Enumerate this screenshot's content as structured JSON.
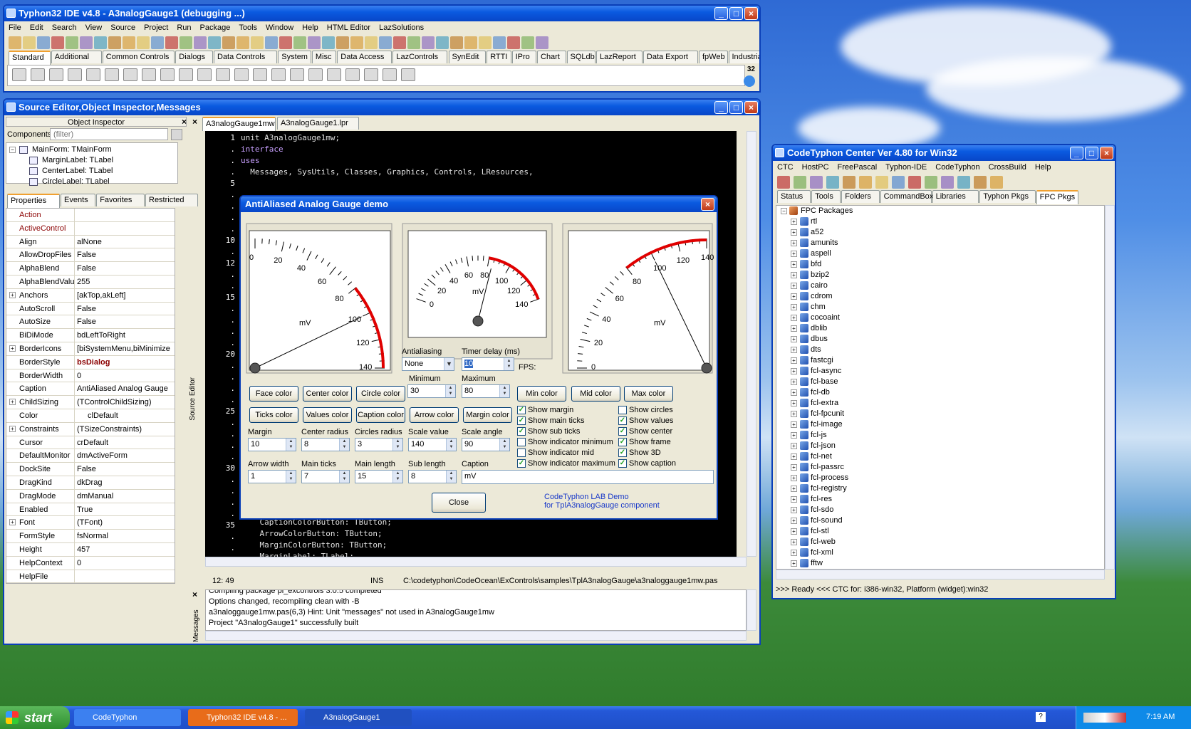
{
  "ide": {
    "title": "Typhon32 IDE v4.8 - A3nalogGauge1 (debugging ...)",
    "menu": [
      "File",
      "Edit",
      "Search",
      "View",
      "Source",
      "Project",
      "Run",
      "Package",
      "Tools",
      "Window",
      "Help",
      "HTML Editor",
      "LazSolutions"
    ],
    "palette_tabs": [
      "Standard",
      "Additional",
      "Common Controls",
      "Dialogs",
      "Data Controls",
      "System",
      "Misc",
      "Data Access",
      "LazControls",
      "SynEdit",
      "RTTI",
      "IPro",
      "Chart",
      "SQLdb",
      "LazReport",
      "Data Export",
      "fpWeb",
      "Industrial",
      "ActiveX",
      "W"
    ],
    "counter": "32"
  },
  "editor": {
    "title": "Source Editor,Object Inspector,Messages",
    "oi_title": "Object Inspector",
    "components_label": "Components",
    "filter_placeholder": "(filter)",
    "tree": [
      "MainForm: TMainForm",
      "MarginLabel: TLabel",
      "CenterLabel: TLabel",
      "CircleLabel: TLabel"
    ],
    "oi_tabs": [
      "Properties",
      "Events",
      "Favorites",
      "Restricted"
    ],
    "props": [
      [
        "Action",
        ""
      ],
      [
        "ActiveControl",
        ""
      ],
      [
        "Align",
        "alNone"
      ],
      [
        "AllowDropFiles",
        "False"
      ],
      [
        "AlphaBlend",
        "False"
      ],
      [
        "AlphaBlendValue",
        "255"
      ],
      [
        "Anchors",
        "[akTop,akLeft]"
      ],
      [
        "AutoScroll",
        "False"
      ],
      [
        "AutoSize",
        "False"
      ],
      [
        "BiDiMode",
        "bdLeftToRight"
      ],
      [
        "BorderIcons",
        "[biSystemMenu,biMinimize"
      ],
      [
        "BorderStyle",
        "bsDialog"
      ],
      [
        "BorderWidth",
        "0"
      ],
      [
        "Caption",
        "AntiAliased Analog Gauge"
      ],
      [
        "ChildSizing",
        "(TControlChildSizing)"
      ],
      [
        "Color",
        "clDefault"
      ],
      [
        "Constraints",
        "(TSizeConstraints)"
      ],
      [
        "Cursor",
        "crDefault"
      ],
      [
        "DefaultMonitor",
        "dmActiveForm"
      ],
      [
        "DockSite",
        "False"
      ],
      [
        "DragKind",
        "dkDrag"
      ],
      [
        "DragMode",
        "dmManual"
      ],
      [
        "Enabled",
        "True"
      ],
      [
        "Font",
        "(TFont)"
      ],
      [
        "FormStyle",
        "fsNormal"
      ],
      [
        "Height",
        "457"
      ],
      [
        "HelpContext",
        "0"
      ],
      [
        "HelpFile",
        ""
      ]
    ],
    "file_tabs": [
      "A3nalogGauge1mw",
      "A3nalogGauge1.lpr"
    ],
    "gutter": [
      "1",
      ".",
      ".",
      ".",
      "5",
      ".",
      ".",
      ".",
      ".",
      "10",
      ".",
      "12",
      ".",
      ".",
      "15",
      ".",
      ".",
      ".",
      ".",
      "20",
      ".",
      ".",
      ".",
      ".",
      "25",
      ".",
      ".",
      ".",
      ".",
      "30",
      ".",
      ".",
      ".",
      ".",
      "35",
      ".",
      "."
    ],
    "code_top": [
      "unit A3nalogGauge1mw;",
      "",
      "interface",
      "",
      "uses",
      "  Messages, SysUtils, Classes, Graphics, Controls, LResources,"
    ],
    "code_bottom": [
      "    CaptionColorButton: TButton;",
      "    ArrowColorButton: TButton;",
      "    MarginColorButton: TButton;",
      "    MarginLabel: TLabel;"
    ],
    "side_label": "Source Editor",
    "status": {
      "pos": "12: 49",
      "mode": "INS",
      "path": "C:\\codetyphon\\CodeOcean\\ExControls\\samples\\TplA3nalogGauge\\a3naloggauge1mw.pas"
    },
    "msg_label": "Messages",
    "messages": [
      "Compiling package pl_excontrols 3.0.5  completed",
      "Options changed, recompiling clean with -B",
      "a3naloggauge1mw.pas(6,3) Hint: Unit \"messages\" not used in A3nalogGauge1mw",
      "Project \"A3nalogGauge1\" successfully built"
    ]
  },
  "dialog": {
    "title": "AntiAliased Analog Gauge demo",
    "gauge_unit": "mV",
    "g1_ticks": [
      "0",
      "20",
      "40",
      "60",
      "80",
      "100",
      "120",
      "140"
    ],
    "antialiasing_label": "Antialiasing",
    "antialiasing_value": "None",
    "timer_label": "Timer delay (ms)",
    "timer_value": "10",
    "fps_label": "FPS:",
    "min_label": "Minimum",
    "min_value": "30",
    "max_label": "Maximum",
    "max_value": "80",
    "buttons_row1": [
      "Face color",
      "Center color",
      "Circle color"
    ],
    "buttons_row1b": [
      "Min color",
      "Mid color",
      "Max color"
    ],
    "buttons_row2": [
      "Ticks color",
      "Values color",
      "Caption color",
      "Arrow color",
      "Margin color"
    ],
    "checks_left": [
      [
        "Show margin",
        true
      ],
      [
        "Show main ticks",
        true
      ],
      [
        "Show sub ticks",
        true
      ],
      [
        "Show indicator minimum",
        false
      ],
      [
        "Show indicator mid",
        false
      ],
      [
        "Show indicator maximum",
        true
      ]
    ],
    "checks_right": [
      [
        "Show circles",
        false
      ],
      [
        "Show values",
        true
      ],
      [
        "Show center",
        true
      ],
      [
        "Show frame",
        true
      ],
      [
        "Show 3D",
        true
      ],
      [
        "Show caption",
        true
      ]
    ],
    "fields_row1": [
      [
        "Margin",
        "10"
      ],
      [
        "Center radius",
        "8"
      ],
      [
        "Circles radius",
        "3"
      ],
      [
        "Scale value",
        "140"
      ],
      [
        "Scale angle",
        "90"
      ]
    ],
    "fields_row2": [
      [
        "Arrow width",
        "1"
      ],
      [
        "Main ticks",
        "7"
      ],
      [
        "Main length",
        "15"
      ],
      [
        "Sub length",
        "8"
      ]
    ],
    "caption_label": "Caption",
    "caption_value": "mV",
    "close": "Close",
    "lab1": "CodeTyphon LAB Demo",
    "lab2": "for TplA3nalogGauge component"
  },
  "ctc": {
    "title": "CodeTyphon Center Ver 4.80 for Win32",
    "menu": [
      "CTC",
      "HostPC",
      "FreePascal",
      "Typhon-IDE",
      "CodeTyphon",
      "CrossBuild",
      "Help"
    ],
    "tabs": [
      "Status",
      "Tools",
      "Folders",
      "CommandBox",
      "Libraries",
      "Typhon Pkgs",
      "FPC Pkgs"
    ],
    "root": "FPC Packages",
    "packages": [
      "rtl",
      "a52",
      "amunits",
      "aspell",
      "bfd",
      "bzip2",
      "cairo",
      "cdrom",
      "chm",
      "cocoaint",
      "dblib",
      "dbus",
      "dts",
      "fastcgi",
      "fcl-async",
      "fcl-base",
      "fcl-db",
      "fcl-extra",
      "fcl-fpcunit",
      "fcl-image",
      "fcl-js",
      "fcl-json",
      "fcl-net",
      "fcl-passrc",
      "fcl-process",
      "fcl-registry",
      "fcl-res",
      "fcl-sdo",
      "fcl-sound",
      "fcl-stl",
      "fcl-web",
      "fcl-xml",
      "fftw"
    ],
    "status": ">>> Ready <<<  CTC for: i386-win32, Platform (widget):win32"
  },
  "taskbar": {
    "start": "start",
    "items": [
      "CodeTyphon",
      "Typhon32 IDE v4.8 - ...",
      "A3nalogGauge1"
    ],
    "clock": "7:19 AM"
  }
}
